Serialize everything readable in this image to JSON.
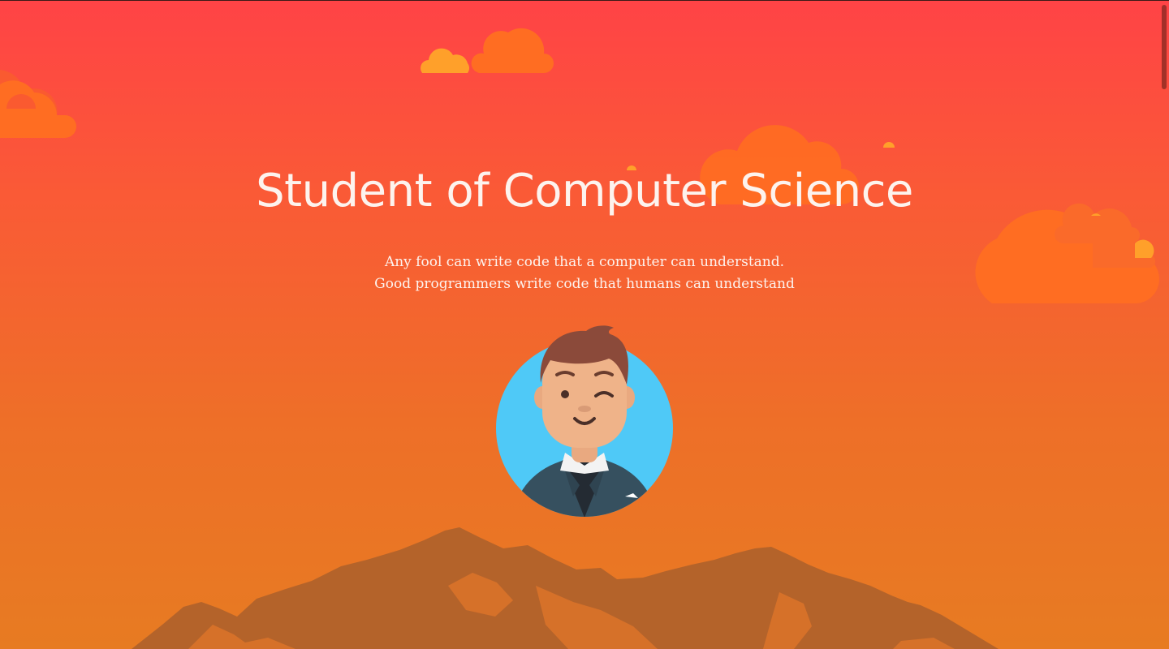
{
  "hero": {
    "title": "Student of Computer Science",
    "quote_line_1": "Any fool can write code that a computer can understand.",
    "quote_line_2": "Good programmers write code that humans can understand"
  },
  "colors": {
    "gradient_top": "#ff4346",
    "gradient_bottom": "#e77b22",
    "cloud_orange": "#ff6d22",
    "cloud_yellow": "#ffa02a",
    "mountain": "#b4632a",
    "avatar_bg": "#4fc9f7",
    "text": "#fdf3ee"
  },
  "icons": {
    "avatar": "avatar-illustration",
    "clouds": "cloud-icon",
    "mountains": "mountain-range"
  }
}
